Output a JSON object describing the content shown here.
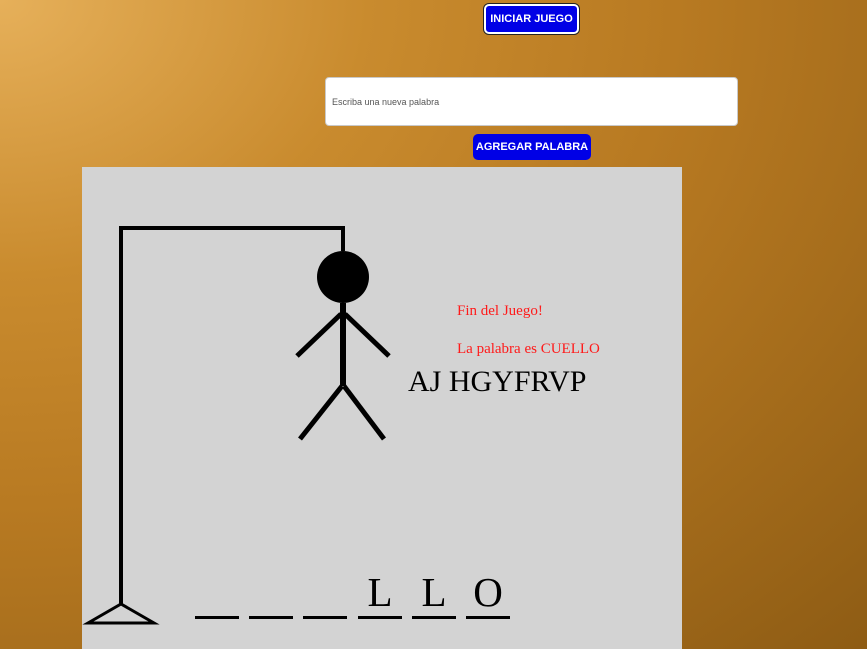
{
  "controls": {
    "start_label": "INICIAR JUEGO",
    "input_placeholder": "Escriba una nueva palabra",
    "input_value": "",
    "add_label": "AGREGAR PALABRA"
  },
  "game": {
    "status_message": "Fin del Juego!",
    "reveal_message": "La palabra es CUELLO",
    "wrong_letters": "AJ HGYFRVP",
    "word_slots": [
      "",
      "",
      "",
      "L",
      "L",
      "O"
    ],
    "errors": 9
  },
  "colors": {
    "button_bg": "#0000e6",
    "board_bg": "#d3d3d3",
    "message": "#ff1a1a",
    "background_gradient": [
      "#e6b05a",
      "#8e5c14"
    ]
  }
}
